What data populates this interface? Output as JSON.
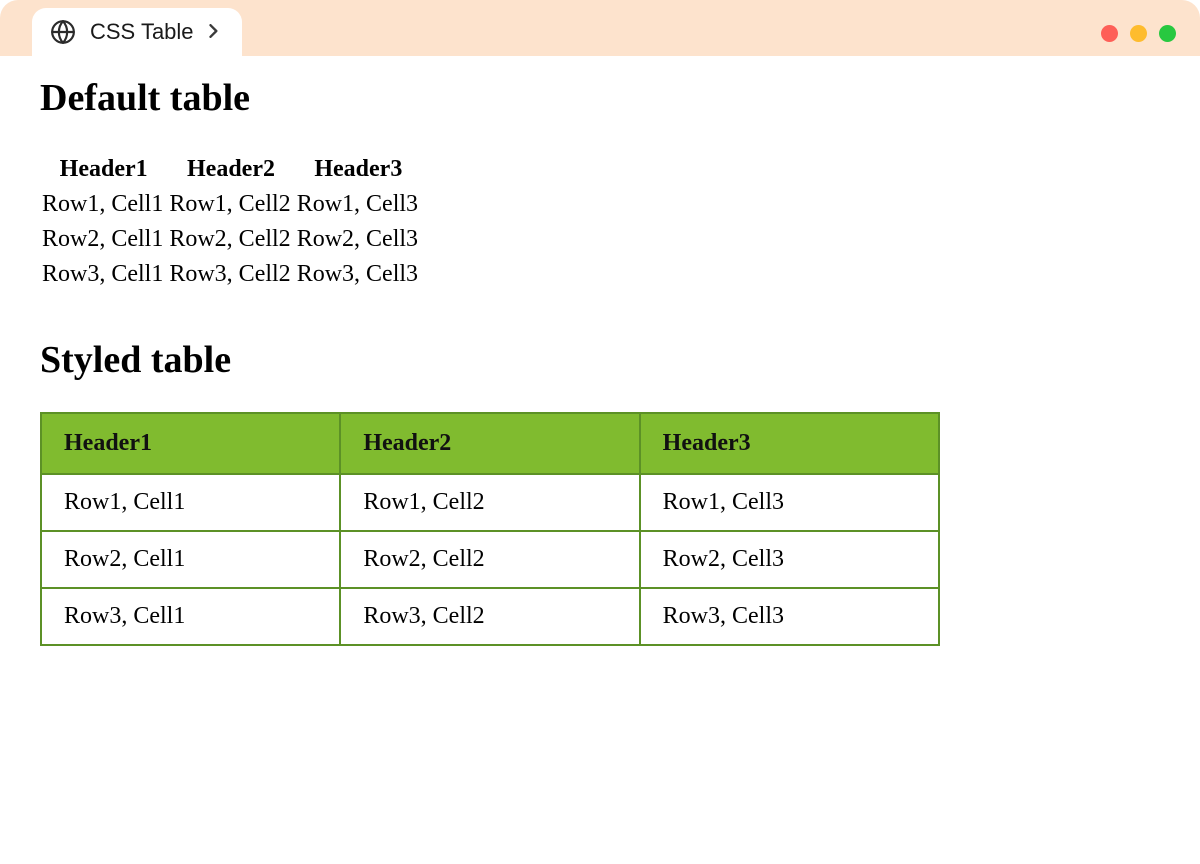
{
  "browser": {
    "tab_title": "CSS Table"
  },
  "headings": {
    "default": "Default table",
    "styled": "Styled table"
  },
  "table1": {
    "headers": [
      "Header1",
      "Header2",
      "Header3"
    ],
    "rows": [
      [
        "Row1, Cell1",
        "Row1, Cell2",
        "Row1, Cell3"
      ],
      [
        "Row2, Cell1",
        "Row2, Cell2",
        "Row2, Cell3"
      ],
      [
        "Row3, Cell1",
        "Row3, Cell2",
        "Row3, Cell3"
      ]
    ]
  },
  "table2": {
    "headers": [
      "Header1",
      "Header2",
      "Header3"
    ],
    "rows": [
      [
        "Row1, Cell1",
        "Row1, Cell2",
        "Row1, Cell3"
      ],
      [
        "Row2, Cell1",
        "Row2, Cell2",
        "Row2, Cell3"
      ],
      [
        "Row3, Cell1",
        "Row3, Cell2",
        "Row3, Cell3"
      ]
    ]
  },
  "colors": {
    "chrome_bg": "#fde3cd",
    "styled_header_bg": "#80bb2f",
    "styled_border": "#5c9126"
  }
}
